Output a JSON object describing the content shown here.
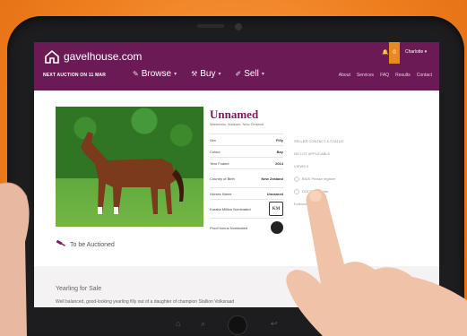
{
  "colors": {
    "brand": "#6c1a55",
    "accent": "#e98a1f",
    "background": "#f28a2a"
  },
  "header": {
    "logo_text": "gavelhouse.com",
    "next_auction": "NEXT AUCTION ON 11 MAR",
    "nav": [
      {
        "label": "Browse",
        "icon": "tag-icon"
      },
      {
        "label": "Buy",
        "icon": "gavel-icon"
      },
      {
        "label": "Sell",
        "icon": "pen-icon"
      }
    ],
    "subnav": [
      "About",
      "Services",
      "FAQ",
      "Results",
      "Contact"
    ],
    "badge_count": "0",
    "user_name": "Charlotte"
  },
  "listing": {
    "title": "Unnamed",
    "location": "Matamata, Waikato, New Zealand",
    "facts": [
      {
        "label": "Sex",
        "value": "Filly"
      },
      {
        "label": "Colour",
        "value": "Bay"
      },
      {
        "label": "Year Foaled",
        "value": "2014"
      },
      {
        "label": "Country of Birth",
        "value": "New Zealand"
      },
      {
        "label": "Horses Name",
        "value": "Unnamed"
      },
      {
        "label": "Karaka Million Nominated",
        "value": "KM"
      },
      {
        "label": "Proof bonus Nominated",
        "value": ""
      }
    ],
    "side_links": [
      "SELLER CONTACT & STATUS",
      "NO LOT APPLICABLE",
      "VIEWS 0",
      "BIDS Please register",
      "DOCS Favourite",
      "Kolkorad"
    ],
    "auction_label": "To be Auctioned",
    "section_title": "Yearling for Sale",
    "description": "Well balanced, good-looking yearling filly out of a daughter of champion Stallion Volksraad"
  }
}
